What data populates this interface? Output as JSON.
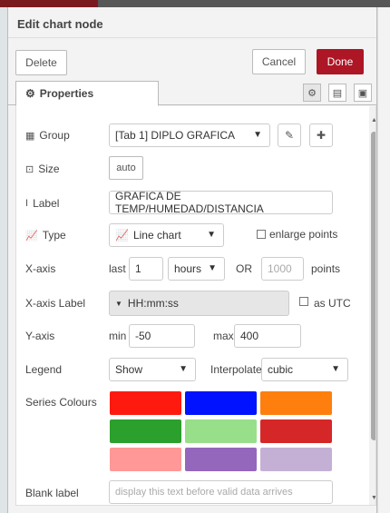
{
  "tray": {
    "title": "Edit chart node",
    "delete_label": "Delete",
    "cancel_label": "Cancel",
    "done_label": "Done"
  },
  "tabs": {
    "properties_label": "Properties"
  },
  "form": {
    "group_label": "Group",
    "group_value": "[Tab 1] DIPLO GRAFICA",
    "size_label": "Size",
    "size_value": "auto",
    "label_label": "Label",
    "label_value": "GRAFICA DE TEMP/HUMEDAD/DISTANCIA",
    "type_label": "Type",
    "type_value": "Line chart",
    "enlarge_points_label": "enlarge points",
    "xaxis_label": "X-axis",
    "last_label": "last",
    "last_value": "1",
    "unit_value": "hours",
    "or_label": "OR",
    "points_placeholder": "1000",
    "points_label": "points",
    "xaxis_label_label": "X-axis Label",
    "xaxis_label_value": "HH:mm:ss",
    "as_utc_label": "as UTC",
    "yaxis_label": "Y-axis",
    "min_label": "min",
    "min_value": "-50",
    "max_label": "max",
    "max_value": "400",
    "legend_label": "Legend",
    "legend_value": "Show",
    "interpolate_label": "Interpolate",
    "interpolate_value": "cubic",
    "series_colours_label": "Series Colours",
    "series_colours": [
      "#ff1a0f",
      "#0012ff",
      "#ff7f0e",
      "#2ca02c",
      "#98df8a",
      "#d62728",
      "#ff9896",
      "#9467bd",
      "#c5b0d5"
    ],
    "blank_label_label": "Blank label",
    "blank_label_placeholder": "display this text before valid data arrives"
  },
  "colors": {
    "done_button": "#ad1625",
    "accent_dark": "#7a1a1e"
  }
}
